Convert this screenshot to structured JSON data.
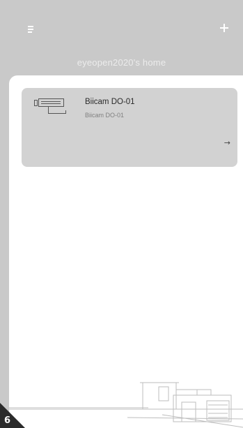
{
  "header": {
    "title": "eyeopen2020's home"
  },
  "devices": [
    {
      "name": "Biicam DO-01",
      "model": "Biicam DO-01",
      "arrow": "→"
    }
  ],
  "badge": {
    "number": "6"
  },
  "colors": {
    "header_bg": "#c9c9c9",
    "card_bg": "#d2d2d2",
    "content_bg": "#ffffff"
  },
  "icons": {
    "menu": "menu-icon",
    "add": "plus-icon",
    "device": "camera-device-icon",
    "arrow": "arrow-right-icon"
  }
}
